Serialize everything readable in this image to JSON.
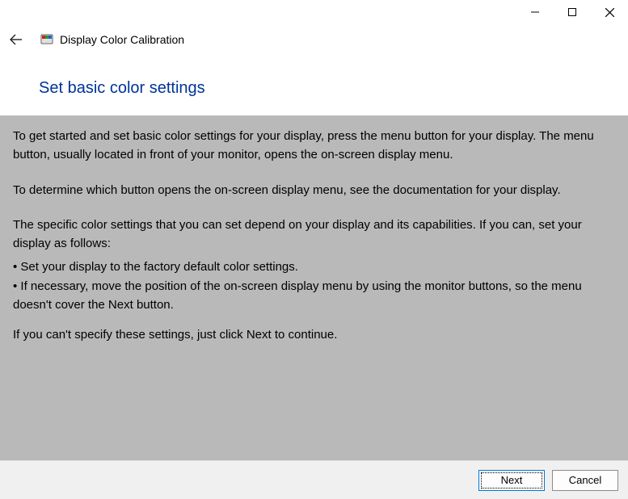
{
  "titlebar": {
    "minimize": "minimize",
    "maximize": "maximize",
    "close": "close"
  },
  "header": {
    "app_title": "Display Color Calibration"
  },
  "main": {
    "heading": "Set basic color settings",
    "para1": "To get started and set basic color settings for your display, press the menu button for your display. The menu button, usually located in front of your monitor, opens the on-screen display menu.",
    "para2": "To determine which button opens the on-screen display menu, see the documentation for your display.",
    "para3": "The specific color settings that you can set depend on your display and its capabilities. If you can, set your display as follows:",
    "bullet1": "• Set your display to the factory default color settings.",
    "bullet2": "• If necessary, move the position of the on-screen display menu by using the monitor buttons, so the menu doesn't cover the Next button.",
    "para4": "If you can't specify these settings,  just click Next to continue."
  },
  "footer": {
    "next_label": "Next",
    "cancel_label": "Cancel"
  }
}
